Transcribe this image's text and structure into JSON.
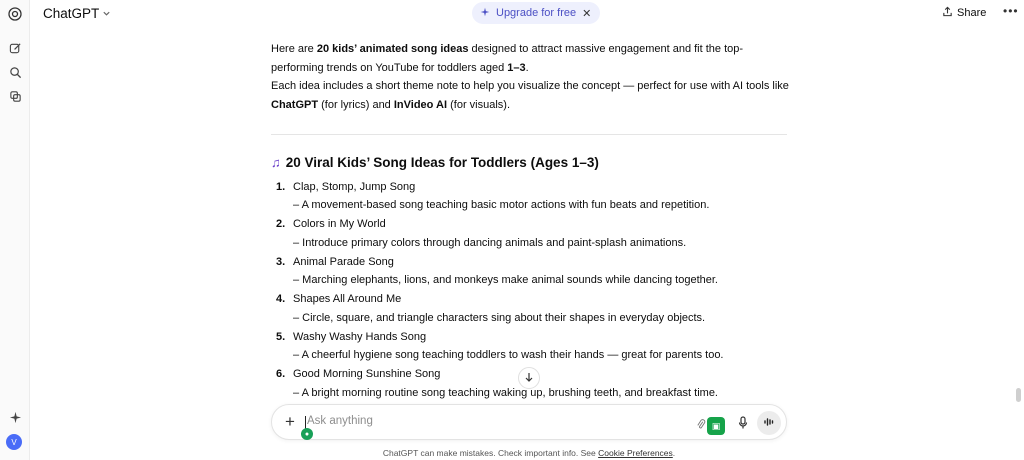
{
  "header": {
    "app_title": "ChatGPT",
    "upgrade_label": "Upgrade for free",
    "share_label": "Share"
  },
  "sidebar": {
    "avatar_initial": "V"
  },
  "content": {
    "intro": {
      "p1_before": "Here are ",
      "p1_bold": "20 kids’ animated song ideas",
      "p1_mid": " designed to attract massive engagement and fit the top-performing trends on YouTube for toddlers aged ",
      "p1_age": "1–3",
      "p1_end": ".",
      "p2_before": "Each idea includes a short theme note to help you visualize the concept — perfect for use with AI tools like ",
      "p2_tool1": "ChatGPT",
      "p2_mid": " (for lyrics) and ",
      "p2_tool2": "InVideo AI",
      "p2_end": " (for visuals)."
    },
    "heading": "20 Viral Kids’ Song Ideas for Toddlers (Ages 1–3)",
    "items": [
      {
        "num": "1.",
        "title": "Clap, Stomp, Jump Song",
        "desc": "– A movement-based song teaching basic motor actions with fun beats and repetition."
      },
      {
        "num": "2.",
        "title": "Colors in My World",
        "desc": "– Introduce primary colors through dancing animals and paint-splash animations."
      },
      {
        "num": "3.",
        "title": "Animal Parade Song",
        "desc": "– Marching elephants, lions, and monkeys make animal sounds while dancing together."
      },
      {
        "num": "4.",
        "title": "Shapes All Around Me",
        "desc": "– Circle, square, and triangle characters sing about their shapes in everyday objects."
      },
      {
        "num": "5.",
        "title": "Washy Washy Hands Song",
        "desc": "– A cheerful hygiene song teaching toddlers to wash their hands — great for parents too."
      },
      {
        "num": "6.",
        "title": "Good Morning Sunshine Song",
        "desc": "– A bright morning routine song teaching waking up, brushing teeth, and breakfast time."
      }
    ]
  },
  "composer": {
    "placeholder": "Ask anything"
  },
  "footer": {
    "text": "ChatGPT can make mistakes. Check important info. See ",
    "link": "Cookie Preferences",
    "end": "."
  }
}
